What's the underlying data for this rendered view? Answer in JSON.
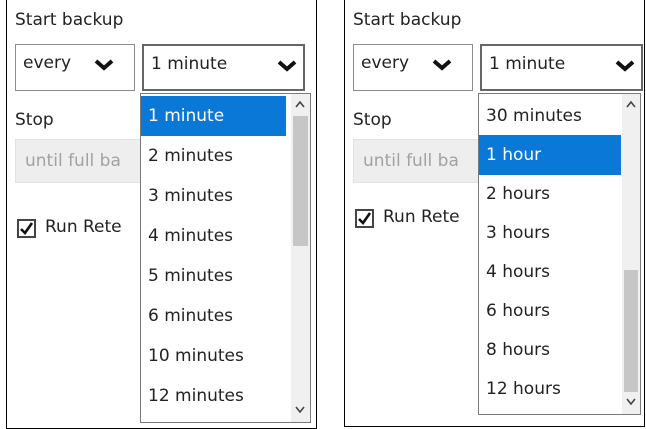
{
  "left": {
    "start_backup_label": "Start backup",
    "frequency_select": {
      "value": "every",
      "icon": "chevron-down-icon"
    },
    "interval_select": {
      "value": "1 minute",
      "icon": "chevron-down-icon"
    },
    "stop_label": "Stop",
    "stop_field": {
      "value": "until full ba"
    },
    "run_retention": {
      "label": "Run Rete",
      "checked": true
    },
    "dropdown": {
      "options": [
        "1 minute",
        "2 minutes",
        "3 minutes",
        "4 minutes",
        "5 minutes",
        "6 minutes",
        "10 minutes",
        "12 minutes"
      ],
      "selected": "1 minute",
      "scroll_position": 0.0
    }
  },
  "right": {
    "start_backup_label": "Start backup",
    "frequency_select": {
      "value": "every",
      "icon": "chevron-down-icon"
    },
    "interval_select": {
      "value": "1 minute",
      "icon": "chevron-down-icon"
    },
    "stop_label": "Stop",
    "stop_field": {
      "value": "until full ba"
    },
    "run_retention": {
      "label": "Run Rete",
      "checked": true
    },
    "dropdown": {
      "options": [
        "30 minutes",
        "1 hour",
        "2 hours",
        "3 hours",
        "4 hours",
        "6 hours",
        "8 hours",
        "12 hours"
      ],
      "selected": "1 hour",
      "scroll_position": 1.0
    }
  },
  "colors": {
    "selection": "#0a78d7",
    "disabled_bg": "#eeeeee",
    "disabled_text": "#a2a2a2",
    "scroll_thumb": "#c6c6c6"
  }
}
